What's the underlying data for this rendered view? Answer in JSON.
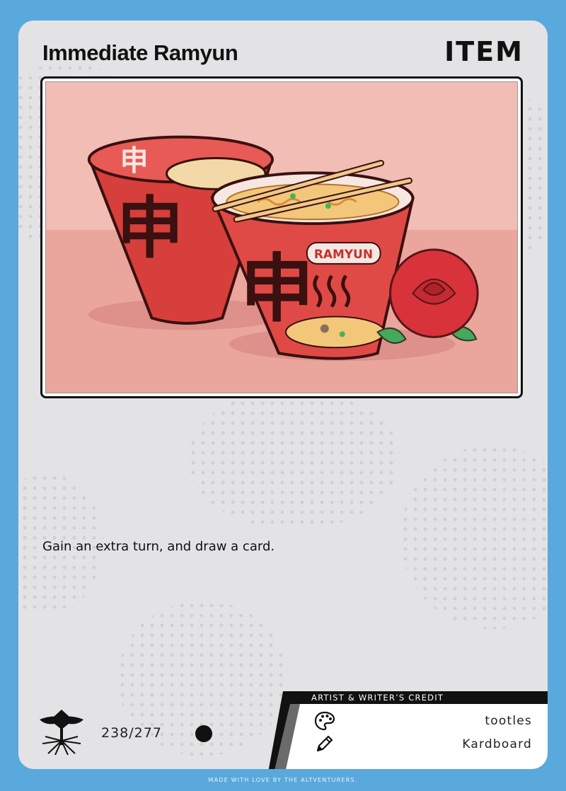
{
  "card": {
    "title": "Immediate Ramyun",
    "type": "ITEM",
    "rules_text": "Gain an extra turn, and draw a card.",
    "collector_number": "238/277",
    "credit_header": "ARTIST & WRITER’S CREDIT",
    "artist": "tootles",
    "writer": "Kardboard",
    "footer": "MADE WITH LOVE BY THE ALTVENTURERS."
  },
  "art": {
    "cup_brand_label": "RAMYUN",
    "cup_logo_glyph": "申"
  },
  "icons": {
    "brand": "altventurers-logo-icon",
    "artist": "palette-icon",
    "writer": "pencil-icon",
    "rarity": "rarity-dot-icon"
  },
  "colors": {
    "frame": "#5aa9dc",
    "card_bg": "#e3e3e5",
    "cup_red": "#e04a46",
    "art_bg": "#f2bdb5"
  }
}
